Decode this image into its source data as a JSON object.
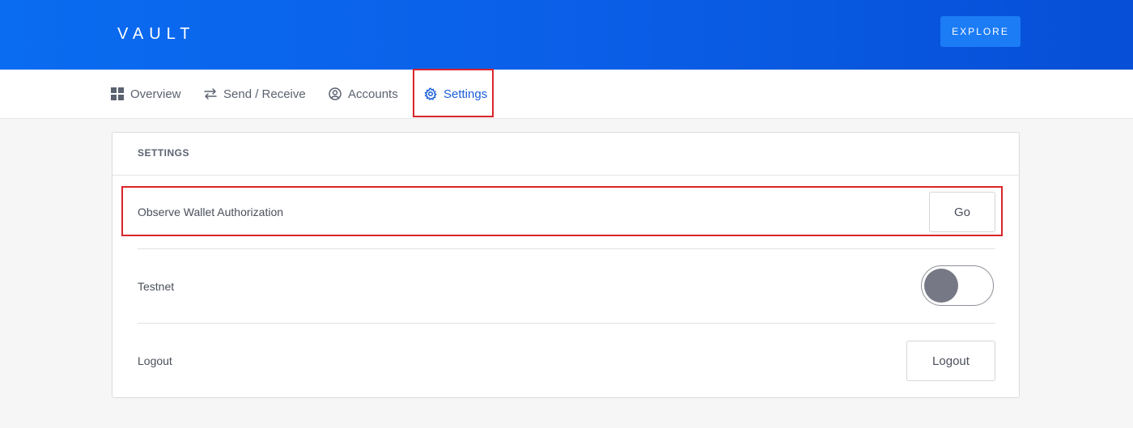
{
  "header": {
    "logo": "VAULT",
    "explore_label": "EXPLORE"
  },
  "nav": {
    "items": [
      {
        "label": "Overview",
        "icon": "grid-icon"
      },
      {
        "label": "Send / Receive",
        "icon": "swap-arrows-icon"
      },
      {
        "label": "Accounts",
        "icon": "user-circle-icon"
      },
      {
        "label": "Settings",
        "icon": "gear-icon",
        "active": true
      }
    ]
  },
  "settings": {
    "title": "SETTINGS",
    "rows": [
      {
        "label": "Observe Wallet Authorization",
        "button": "Go"
      },
      {
        "label": "Testnet",
        "toggle_on": false
      },
      {
        "label": "Logout",
        "button": "Logout"
      }
    ]
  },
  "colors": {
    "header_start": "#0a6cf0",
    "header_end": "#064fd6",
    "accent": "#1a5fd6",
    "highlight": "#d9252a",
    "toggle_knob": "#767985"
  }
}
